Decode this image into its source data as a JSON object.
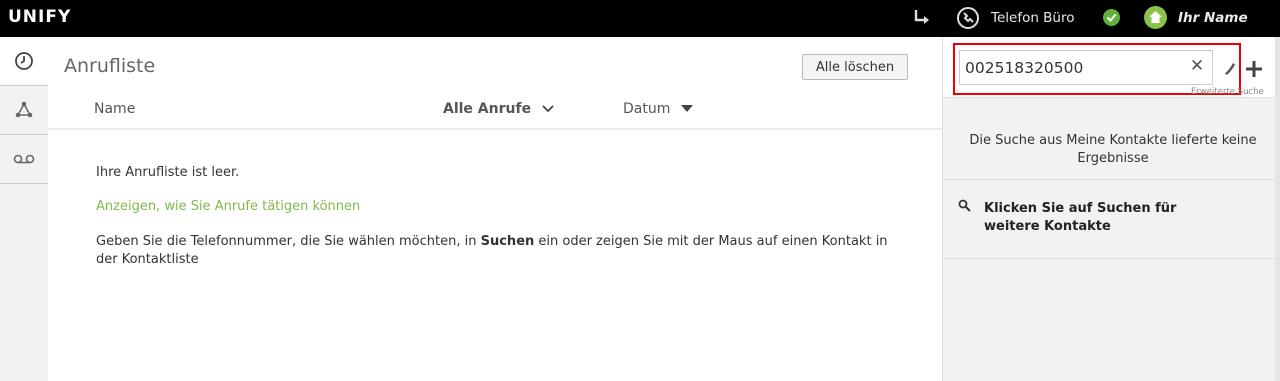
{
  "topbar": {
    "logo": "UNIFY",
    "device_label": "Telefon Büro",
    "user_name": "Ihr Name"
  },
  "main": {
    "title": "Anrufliste",
    "clear_button": "Alle löschen",
    "columns": {
      "name": "Name",
      "filter": "Alle Anrufe",
      "date": "Datum"
    },
    "empty_text": "Ihre Anrufliste ist leer.",
    "howto_link": "Anzeigen, wie Sie Anrufe tätigen können",
    "instructions_part1": "Geben Sie die Telefonnummer, die Sie wählen möchten, in ",
    "instructions_bold": "Suchen",
    "instructions_part2": " ein oder zeigen Sie mit der Maus auf einen Kontakt in der Kontaktliste"
  },
  "search": {
    "value": "002518320500",
    "advanced_label": "Erweiterte Suche",
    "no_result": "Die Suche aus Meine Kontakte lieferte keine Ergebnisse",
    "hint": "Klicken Sie auf Suchen für weitere Kontakte"
  },
  "colors": {
    "accent_green": "#7fb949",
    "status_green": "#5fb33d",
    "highlight_red": "#ee0000"
  }
}
